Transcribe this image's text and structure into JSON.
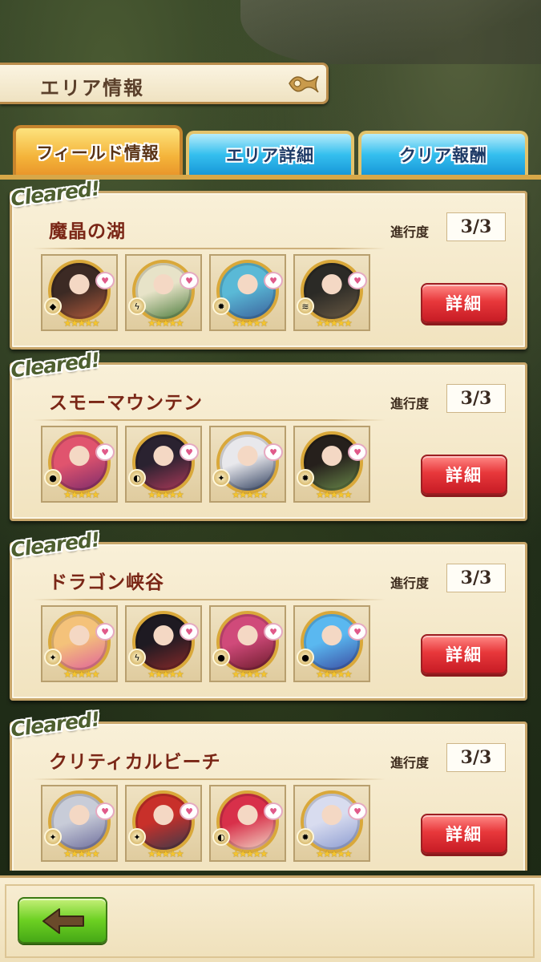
{
  "header": {
    "title": "エリア情報"
  },
  "tabs": [
    {
      "label": "フィールド情報",
      "active": true
    },
    {
      "label": "エリア詳細",
      "active": false
    },
    {
      "label": "クリア報酬",
      "active": false
    }
  ],
  "fields": [
    {
      "status": "Cleared!",
      "name": "魔晶の湖",
      "progress_label": "進行度",
      "progress": "3/3",
      "detail_label": "詳細",
      "heroes": [
        {
          "portrait_colors": [
            "#3c2a24",
            "#b25a3c"
          ],
          "element_icon": "earth-icon",
          "stars": "★★★★★"
        },
        {
          "portrait_colors": [
            "#e7e3c8",
            "#4a7a3a"
          ],
          "element_icon": "lightning-icon",
          "stars": "★★★★★"
        },
        {
          "portrait_colors": [
            "#5ab9d6",
            "#3a5f9a"
          ],
          "element_icon": "fire-icon",
          "stars": "★★★★★"
        },
        {
          "portrait_colors": [
            "#2b2a26",
            "#6a5a44"
          ],
          "element_icon": "wind-icon",
          "stars": "★★★★★"
        }
      ]
    },
    {
      "status": "Cleared!",
      "name": "スモーマウンテン",
      "progress_label": "進行度",
      "progress": "3/3",
      "detail_label": "詳細",
      "heroes": [
        {
          "portrait_colors": [
            "#e0546e",
            "#7a2a6a"
          ],
          "element_icon": "water-icon",
          "stars": "★★★★★"
        },
        {
          "portrait_colors": [
            "#2a2230",
            "#b03a5a"
          ],
          "element_icon": "dark-icon",
          "stars": "★★★★★"
        },
        {
          "portrait_colors": [
            "#e8e8ec",
            "#2a3a5a"
          ],
          "element_icon": "light-icon",
          "stars": "★★★★★"
        },
        {
          "portrait_colors": [
            "#26201c",
            "#6a8a4a"
          ],
          "element_icon": "fire-icon",
          "stars": "★★★★★"
        }
      ]
    },
    {
      "status": "Cleared!",
      "name": "ドラゴン峡谷",
      "progress_label": "進行度",
      "progress": "3/3",
      "detail_label": "詳細",
      "heroes": [
        {
          "portrait_colors": [
            "#f4c27a",
            "#e0609a"
          ],
          "element_icon": "light-icon",
          "stars": "★★★★★"
        },
        {
          "portrait_colors": [
            "#1e1a22",
            "#8a2a2a"
          ],
          "element_icon": "lightning-icon",
          "stars": "★★★★★"
        },
        {
          "portrait_colors": [
            "#d04a7a",
            "#6a1a2a"
          ],
          "element_icon": "water-icon",
          "stars": "★★★★★"
        },
        {
          "portrait_colors": [
            "#5ab8f0",
            "#3a4aa0"
          ],
          "element_icon": "water-icon",
          "stars": "★★★★★"
        }
      ]
    },
    {
      "status": "Cleared!",
      "name": "クリティカルビーチ",
      "progress_label": "進行度",
      "progress": "3/3",
      "detail_label": "詳細",
      "heroes": [
        {
          "portrait_colors": [
            "#c8ccd8",
            "#6a6a9a"
          ],
          "element_icon": "light-icon",
          "stars": "★★★★★"
        },
        {
          "portrait_colors": [
            "#c8302a",
            "#3a3a4a"
          ],
          "element_icon": "light-icon",
          "stars": "★★★★★"
        },
        {
          "portrait_colors": [
            "#d8304a",
            "#f2d8c8"
          ],
          "element_icon": "dark-icon",
          "stars": "★★★★★"
        },
        {
          "portrait_colors": [
            "#d8dcef",
            "#8a9ad0"
          ],
          "element_icon": "fire-icon",
          "stars": "★★★★★"
        }
      ]
    }
  ],
  "footer": {
    "back_icon": "back-arrow-icon"
  },
  "colors": {
    "tab_active": "#f4b43a",
    "tab_inactive": "#35bfee",
    "detail_button": "#e8383b",
    "back_button": "#6cd022",
    "cleared_text": "#4e5f2f",
    "field_name": "#7a2616"
  }
}
